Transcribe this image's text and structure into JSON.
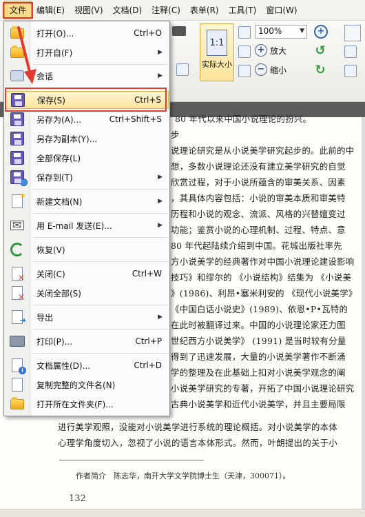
{
  "menubar": {
    "items": [
      "文件",
      "编辑(E)",
      "视图(V)",
      "文档(D)",
      "注释(C)",
      "表单(R)",
      "工具(T)",
      "窗口(W)"
    ]
  },
  "ribbon": {
    "actual_size_label": "实际大小",
    "actual_size_icon_text": "1:1",
    "zoom_value": "100%",
    "zoom_in_label": "放大",
    "zoom_out_label": "缩小"
  },
  "file_menu": {
    "items": [
      {
        "label": "打开(O)...",
        "shortcut": "Ctrl+O",
        "icon": "open-folder-icon",
        "submenu": false
      },
      {
        "label": "打开自(F)",
        "shortcut": "",
        "icon": "open-from-folder-icon",
        "submenu": true
      },
      {
        "label": "会话",
        "shortcut": "",
        "icon": "session-icon",
        "submenu": true
      },
      {
        "label": "保存(S)",
        "shortcut": "Ctrl+S",
        "icon": "save-disk-icon",
        "submenu": false,
        "highlighted": true
      },
      {
        "label": "另存为(A)...",
        "shortcut": "Ctrl+Shift+S",
        "icon": "save-as-icon",
        "submenu": false
      },
      {
        "label": "另存为副本(Y)...",
        "shortcut": "",
        "icon": "save-copy-icon",
        "submenu": false
      },
      {
        "label": "全部保存(L)",
        "shortcut": "",
        "icon": "save-all-icon",
        "submenu": false
      },
      {
        "label": "保存到(T)",
        "shortcut": "",
        "icon": "save-to-icon",
        "submenu": true
      },
      {
        "label": "新建文档(N)",
        "shortcut": "",
        "icon": "new-document-icon",
        "submenu": true
      },
      {
        "label": "用 E-mail 发送(E)...",
        "shortcut": "",
        "icon": "email-icon",
        "submenu": true
      },
      {
        "label": "恢复(V)",
        "shortcut": "",
        "icon": "restore-icon",
        "submenu": false
      },
      {
        "label": "关闭(C)",
        "shortcut": "Ctrl+W",
        "icon": "close-document-icon",
        "submenu": false
      },
      {
        "label": "关闭全部(S)",
        "shortcut": "",
        "icon": "close-all-icon",
        "submenu": false
      },
      {
        "label": "导出",
        "shortcut": "",
        "icon": "export-icon",
        "submenu": true
      },
      {
        "label": "打印(P)...",
        "shortcut": "Ctrl+P",
        "icon": "printer-icon",
        "submenu": false
      },
      {
        "label": "文档属性(D)...",
        "shortcut": "Ctrl+D",
        "icon": "document-properties-icon",
        "submenu": false
      },
      {
        "label": "复制完整的文件名(N)",
        "shortcut": "",
        "icon": "copy-filename-icon",
        "submenu": false
      },
      {
        "label": "打开所在文件夹(F)...",
        "shortcut": "",
        "icon": "open-containing-folder-icon",
        "submenu": false
      }
    ]
  },
  "document": {
    "lines": [
      "80 年代以来中国小说理论的扮兴。",
      "步",
      "说理论研究是从小说美学研究起步的。此前的中",
      "想，多数小说理论还没有建立美学研究的自觉",
      "欣赏过程，对于小说所蕴含的审美关系、因素",
      "，其具体内容包括：小说的审美本质和审美特",
      "历程和小说的观念、流派、风格的兴替嬗变过",
      "功能；鉴赏小说的心理机制、过程、特点、意",
      "80 年代起陆续介绍到中国。花城出版社率先",
      "方小说美学的经典著作对中国小说理论建设影响",
      "技巧》和缪尔的 《小说结构》结集为 《小说美",
      "》(1986)、利昂•塞米利安的 《现代小说美学》",
      "《中国白话小说史》(1989)、依恩•P•瓦特的",
      "在此时被翻译过来。中国的小说理论家还力图",
      "世纪西方小说美学》 (1991) 是当时较有分量",
      "得到了迅速发展，大量的小说美学著作不断涌",
      "学的整理及在此基础上扣对小说美学观念的阐",
      "小说美学研究的专著，开拓了中国小说理论研究",
      "古典小说美学和近代小说美学，并且主要局限",
      "进行美学观照，没能对小说美学进行系统的理论概括。对小说美学的本体",
      "心理学角度切入，忽视了小说的语言本体形式。然而，叶朗提出的关于小"
    ],
    "author_note": "作者简介　陈志华，南开大学文学院博士生（天津，300071）。",
    "page_number": "132"
  }
}
